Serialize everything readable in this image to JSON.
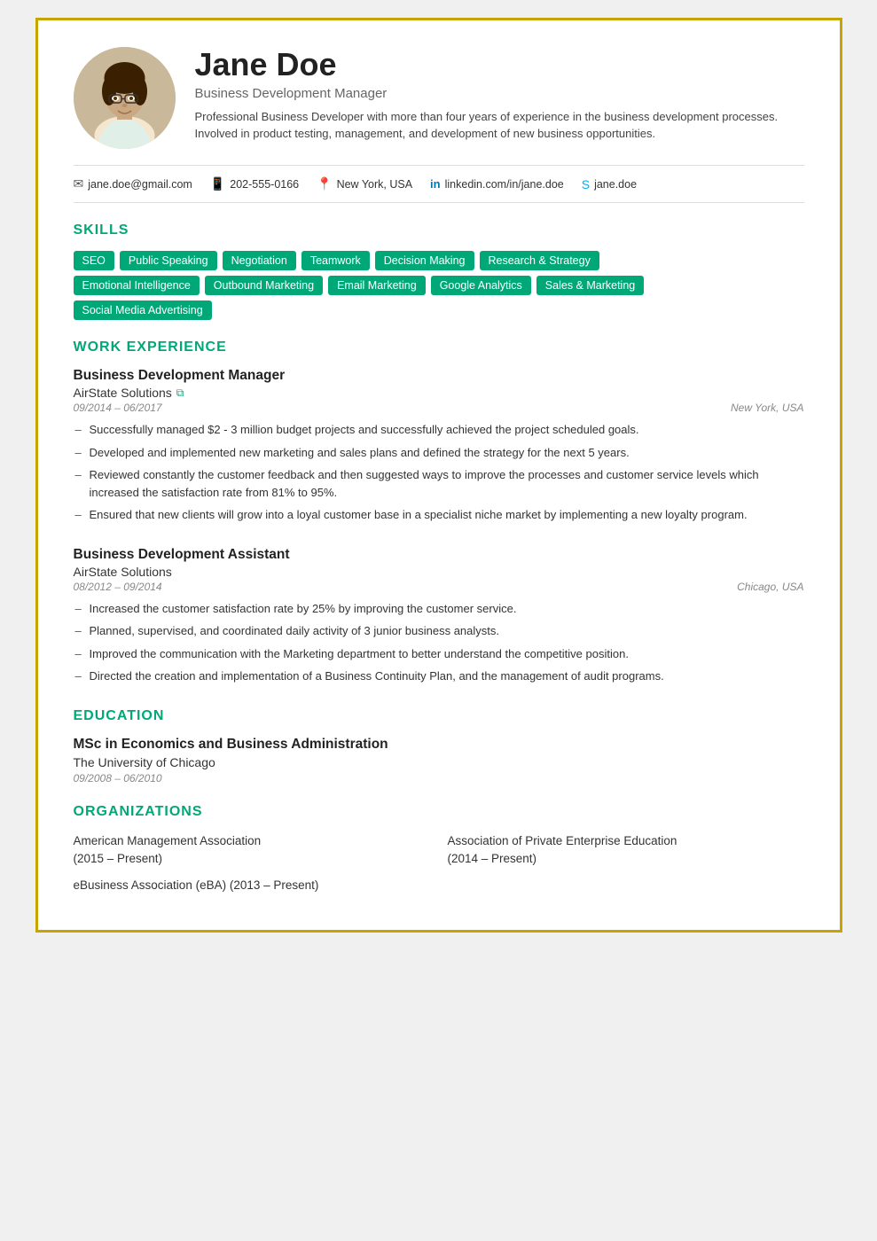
{
  "header": {
    "name": "Jane Doe",
    "title": "Business Development Manager",
    "bio": "Professional Business Developer with more than four years of experience in the business development processes. Involved in product testing, management, and development of new business opportunities."
  },
  "contact": [
    {
      "icon": "email",
      "text": "jane.doe@gmail.com"
    },
    {
      "icon": "phone",
      "text": "202-555-0166"
    },
    {
      "icon": "location",
      "text": "New York, USA"
    },
    {
      "icon": "linkedin",
      "text": "linkedin.com/in/jane.doe"
    },
    {
      "icon": "skype",
      "text": "jane.doe"
    }
  ],
  "skills": {
    "section_title": "SKILLS",
    "rows": [
      [
        "SEO",
        "Public Speaking",
        "Negotiation",
        "Teamwork",
        "Decision Making",
        "Research & Strategy"
      ],
      [
        "Emotional Intelligence",
        "Outbound Marketing",
        "Email Marketing",
        "Google Analytics",
        "Sales & Marketing"
      ],
      [
        "Social Media Advertising"
      ]
    ]
  },
  "work_experience": {
    "section_title": "WORK EXPERIENCE",
    "jobs": [
      {
        "title": "Business Development Manager",
        "company": "AirState Solutions",
        "has_link": true,
        "dates": "09/2014 – 06/2017",
        "location": "New York, USA",
        "bullets": [
          "Successfully managed $2 - 3 million budget projects and successfully achieved the project scheduled goals.",
          "Developed and implemented new marketing and sales plans and defined the strategy for the next 5 years.",
          "Reviewed constantly the customer feedback and then suggested ways to improve the processes and customer service levels which increased the satisfaction rate from 81% to 95%.",
          "Ensured that new clients will grow into a loyal customer base in a specialist niche market by implementing a new loyalty program."
        ]
      },
      {
        "title": "Business Development Assistant",
        "company": "AirState Solutions",
        "has_link": false,
        "dates": "08/2012 – 09/2014",
        "location": "Chicago, USA",
        "bullets": [
          "Increased the customer satisfaction rate by 25% by improving the customer service.",
          "Planned, supervised, and coordinated daily activity of 3 junior business analysts.",
          "Improved the communication with the Marketing department to better understand the competitive position.",
          "Directed the creation and implementation of a Business Continuity Plan, and the management of audit programs."
        ]
      }
    ]
  },
  "education": {
    "section_title": "EDUCATION",
    "entries": [
      {
        "degree": "MSc in Economics and Business Administration",
        "school": "The University of Chicago",
        "dates": "09/2008 – 06/2010"
      }
    ]
  },
  "organizations": {
    "section_title": "ORGANIZATIONS",
    "items": [
      {
        "name": "American Management Association",
        "dates": "(2015 – Present)",
        "full_width": false
      },
      {
        "name": "Association of Private Enterprise Education",
        "dates": "(2014 – Present)",
        "full_width": false
      },
      {
        "name": "eBusiness Association (eBA) (2013 – Present)",
        "dates": "",
        "full_width": true
      }
    ]
  }
}
